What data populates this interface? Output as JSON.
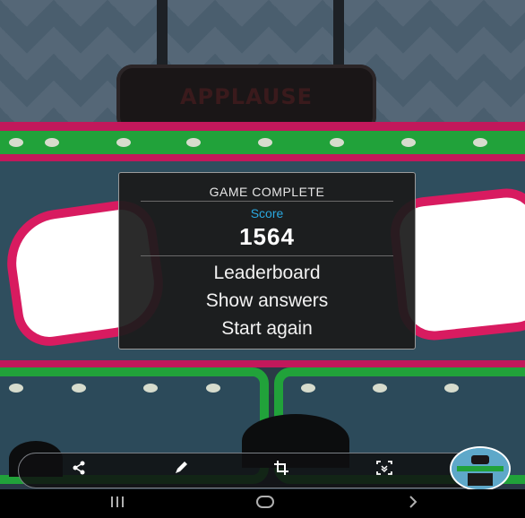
{
  "game": {
    "sign_text": "APPLAUSE",
    "modal": {
      "title": "GAME COMPLETE",
      "score_label": "Score",
      "score_value": "1564",
      "options": [
        "Leaderboard",
        "Show answers",
        "Start again"
      ]
    }
  },
  "toolbar": {
    "share_icon": "share-icon",
    "edit_icon": "pencil-icon",
    "crop_icon": "crop-icon",
    "scroll_capture_icon": "scroll-capture-icon"
  },
  "navbar": {
    "recent_icon": "recent-apps-icon",
    "home_icon": "home-icon",
    "back_icon": "back-icon"
  },
  "colors": {
    "accent_score": "#2aa8e0",
    "rail_green": "#21a23a",
    "rail_pink": "#c2185b"
  }
}
